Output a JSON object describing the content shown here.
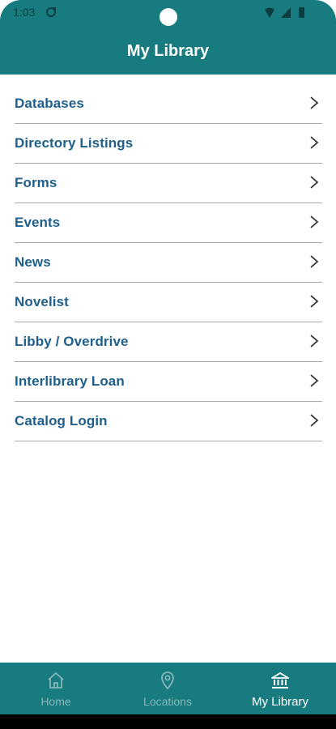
{
  "status_bar": {
    "time": "1:03"
  },
  "header": {
    "title": "My Library"
  },
  "menu": {
    "items": [
      {
        "label": "Databases"
      },
      {
        "label": "Directory Listings"
      },
      {
        "label": "Forms"
      },
      {
        "label": "Events"
      },
      {
        "label": "News"
      },
      {
        "label": "Novelist"
      },
      {
        "label": "Libby / Overdrive"
      },
      {
        "label": "Interlibrary Loan"
      },
      {
        "label": "Catalog Login"
      }
    ]
  },
  "bottom_nav": {
    "items": [
      {
        "label": "Home",
        "icon": "home-icon",
        "active": false
      },
      {
        "label": "Locations",
        "icon": "location-pin-icon",
        "active": false
      },
      {
        "label": "My Library",
        "icon": "library-building-icon",
        "active": true
      }
    ]
  },
  "colors": {
    "primary": "#187b7f",
    "menu_text": "#1f5f8b",
    "divider": "#a7a7a7",
    "nav_inactive": "#86b8ba"
  }
}
